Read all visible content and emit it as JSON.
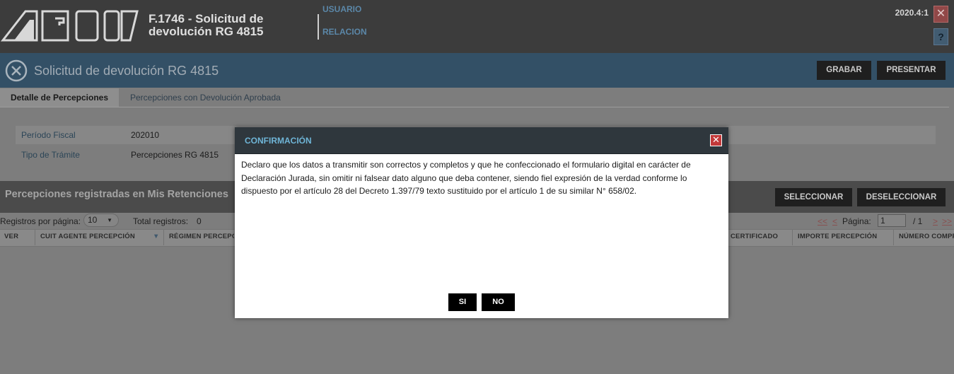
{
  "header": {
    "app_title_line1": "F.1746 - Solicitud de",
    "app_title_line2": "devolución RG 4815",
    "nav": [
      "USUARIO",
      "RELACION"
    ],
    "version": "2020.4:1",
    "close_glyph": "✕",
    "help_glyph": "?"
  },
  "titlebar": {
    "title": "Solicitud de devolución RG 4815",
    "grabar": "GRABAR",
    "presentar": "PRESENTAR"
  },
  "tabs": [
    "Detalle de Percepciones",
    "Percepciones con Devolución Aprobada"
  ],
  "form": {
    "periodo_label": "Período Fiscal",
    "periodo_value": "202010",
    "tramite_label": "Tipo de Trámite",
    "tramite_value": "Percepciones RG 4815"
  },
  "section": {
    "title": "Percepciones registradas en Mis Retenciones",
    "seleccionar": "SELECCIONAR",
    "deseleccionar": "DESELECCIONAR"
  },
  "pager": {
    "registros_label": "Registros por página:",
    "registros_value": "10",
    "total_label": "Total registros:",
    "total_value": "0",
    "first": "<<",
    "prev": "<",
    "pagina_label": "Página:",
    "page_value": "1",
    "of_text": "/  1",
    "next": ">",
    "last": ">>"
  },
  "table": {
    "columns": [
      "VER",
      "CUIT AGENTE PERCEPCIÓN",
      "RÉGIMEN PERCEPCIÓN",
      "CERTIFICADO",
      "IMPORTE PERCEPCIÓN",
      "NÚMERO COMPROBANTE"
    ]
  },
  "modal": {
    "title": "CONFIRMACIÓN",
    "message": "Declaro que los datos a transmitir son correctos y completos y que he confeccionado el formulario digital en carácter de Declaración Jurada, sin omitir ni falsear dato alguno que deba contener, siendo fiel expresión de la verdad conforme lo dispuesto por el artículo 28 del Decreto 1.397/79 texto sustituido por el artículo 1 de su similar N° 658/02.",
    "yes": "SI",
    "no": "NO",
    "close_glyph": "✕"
  },
  "colors": {
    "overlay_bg": "#7d7d7d",
    "header_bg": "#3c3c3c",
    "titlebar_bg": "#335066",
    "modal_header_bg": "#2f373d",
    "modal_title": "#6fb5d7",
    "close_red": "#c3393a"
  },
  "icons": [
    "afip-logo",
    "close-circle-icon",
    "close-icon",
    "help-icon",
    "chevron-down-icon",
    "sort-down-icon"
  ]
}
